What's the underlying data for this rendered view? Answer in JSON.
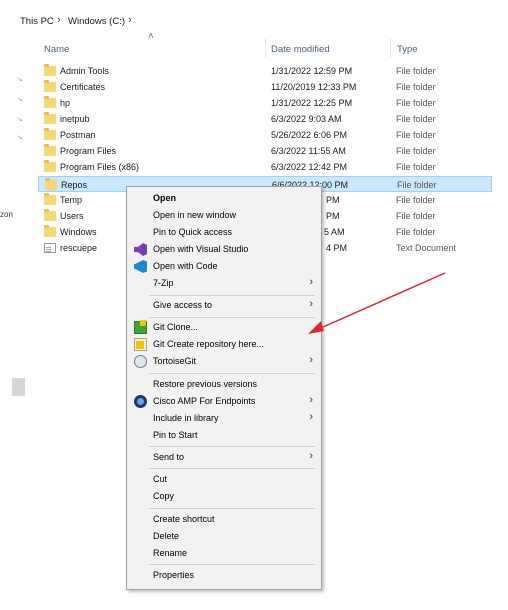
{
  "breadcrumb": {
    "items": [
      "This PC",
      "Windows (C:)"
    ],
    "separator": "›"
  },
  "columns": {
    "name": "Name",
    "date_modified": "Date modified",
    "type": "Type"
  },
  "left_panel": {
    "clipped_text": "zon"
  },
  "files": [
    {
      "name": "Admin Tools",
      "date": "1/31/2022 12:59 PM",
      "type": "File folder",
      "icon": "folder-icon"
    },
    {
      "name": "Certificates",
      "date": "11/20/2019 12:33 PM",
      "type": "File folder",
      "icon": "folder-icon"
    },
    {
      "name": "hp",
      "date": "1/31/2022 12:25 PM",
      "type": "File folder",
      "icon": "folder-icon"
    },
    {
      "name": "inetpub",
      "date": "6/3/2022 9:03 AM",
      "type": "File folder",
      "icon": "folder-icon"
    },
    {
      "name": "Postman",
      "date": "5/26/2022 6:06 PM",
      "type": "File folder",
      "icon": "folder-icon"
    },
    {
      "name": "Program Files",
      "date": "6/3/2022 11:55 AM",
      "type": "File folder",
      "icon": "folder-icon"
    },
    {
      "name": "Program Files (x86)",
      "date": "6/3/2022 12:42 PM",
      "type": "File folder",
      "icon": "folder-icon"
    },
    {
      "name": "Repos",
      "date": "6/6/2022 12:00 PM",
      "type": "File folder",
      "icon": "folder-icon",
      "selected": true
    },
    {
      "name": "Temp",
      "date": "PM",
      "type": "File folder",
      "icon": "folder-icon"
    },
    {
      "name": "Users",
      "date": "PM",
      "type": "File folder",
      "icon": "folder-icon"
    },
    {
      "name": "Windows",
      "date": "5 AM",
      "type": "File folder",
      "icon": "folder-icon"
    },
    {
      "name": "rescuepe",
      "date": "4 PM",
      "type": "Text Document",
      "icon": "text-document-icon"
    }
  ],
  "context_menu": {
    "items": [
      {
        "label": "Open",
        "bold": true
      },
      {
        "label": "Open in new window"
      },
      {
        "label": "Pin to Quick access"
      },
      {
        "label": "Open with Visual Studio",
        "icon": "visual-studio-icon"
      },
      {
        "label": "Open with Code",
        "icon": "vscode-icon"
      },
      {
        "label": "7-Zip",
        "submenu": true
      },
      {
        "label": "Give access to",
        "submenu": true
      },
      {
        "label": "Git Clone...",
        "icon": "git-clone-icon"
      },
      {
        "label": "Git Create repository here...",
        "icon": "git-create-repo-icon"
      },
      {
        "label": "TortoiseGit",
        "icon": "tortoisegit-icon",
        "submenu": true
      },
      {
        "label": "Restore previous versions"
      },
      {
        "label": "Cisco AMP For Endpoints",
        "icon": "cisco-amp-icon",
        "submenu": true
      },
      {
        "label": "Include in library",
        "submenu": true
      },
      {
        "label": "Pin to Start"
      },
      {
        "label": "Send to",
        "submenu": true
      },
      {
        "label": "Cut"
      },
      {
        "label": "Copy"
      },
      {
        "label": "Create shortcut"
      },
      {
        "label": "Delete"
      },
      {
        "label": "Rename"
      },
      {
        "label": "Properties"
      }
    ],
    "submenu_glyph": "›"
  },
  "annotation": {
    "arrow_color": "#e0262b",
    "points_to": "Git Clone..."
  },
  "colors": {
    "selection_bg": "#cce8ff",
    "selection_border": "#99d1ff",
    "folder": "#f8d775",
    "menu_bg": "#f2f2f2"
  }
}
